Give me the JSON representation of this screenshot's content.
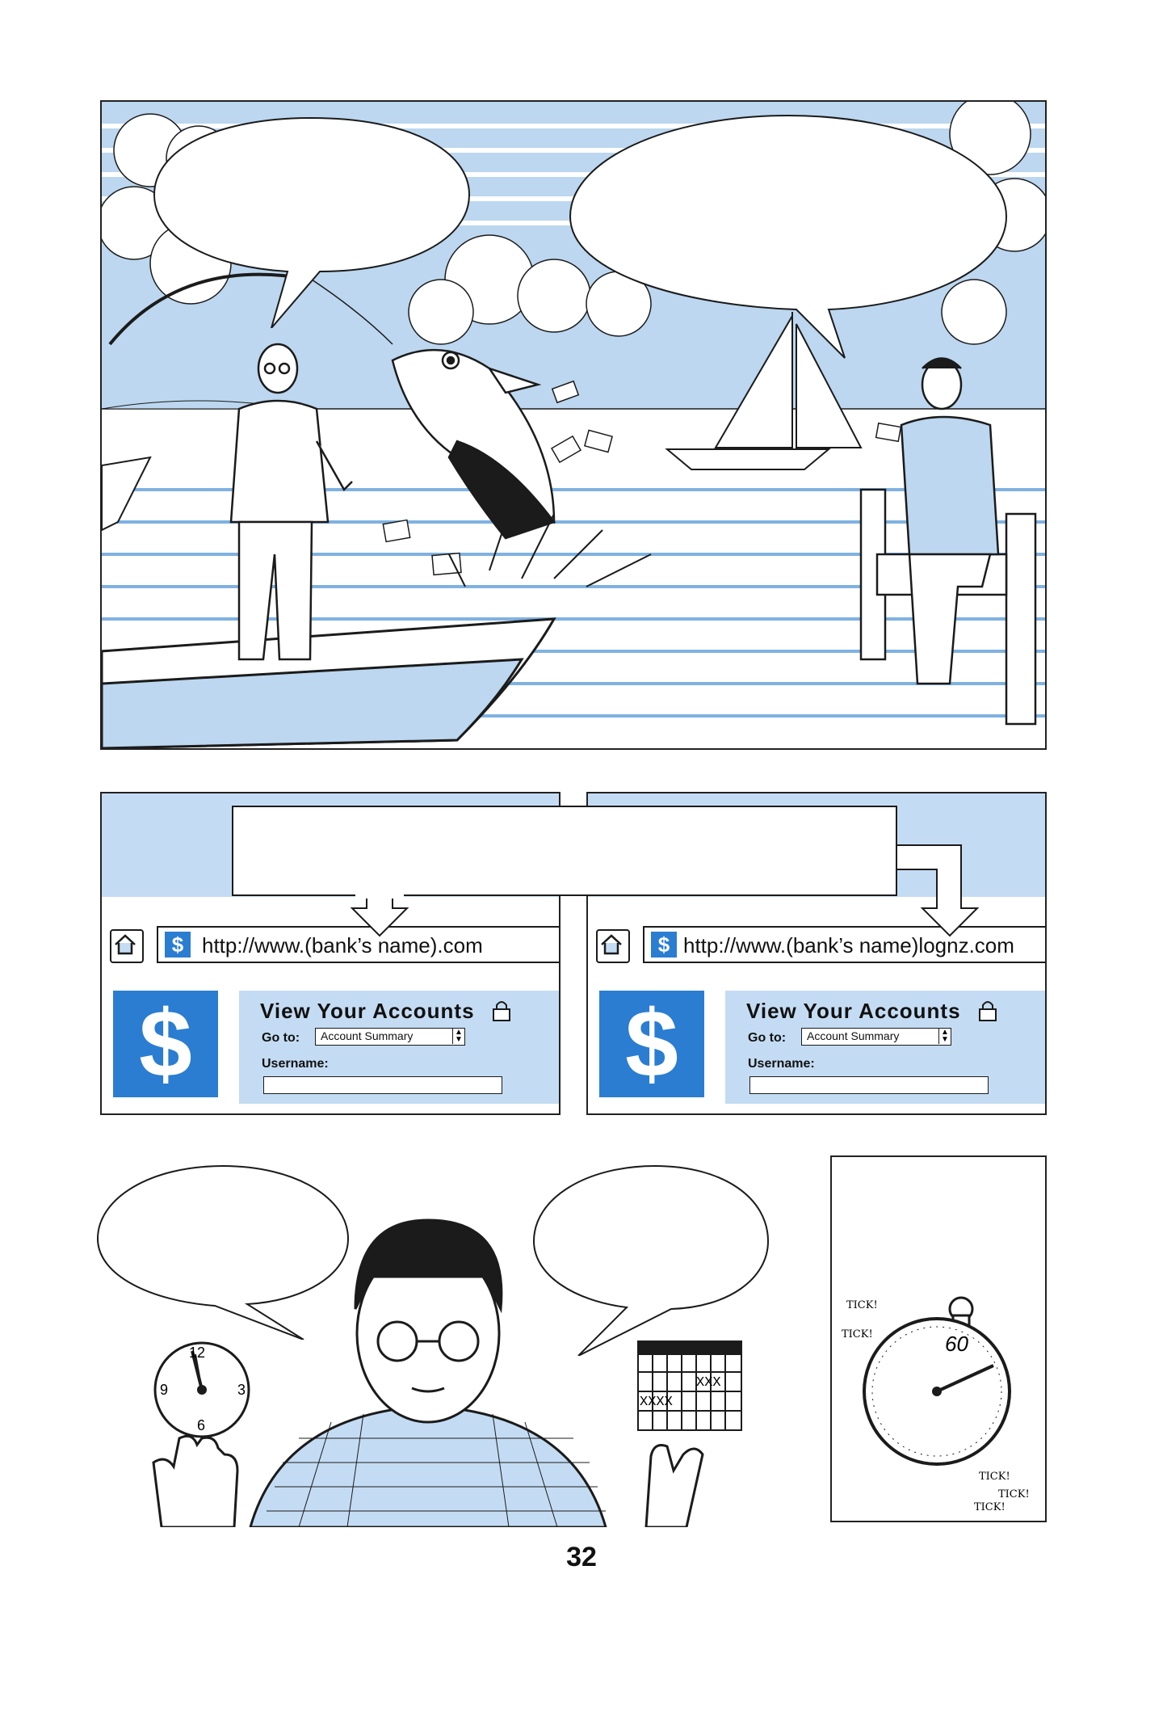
{
  "page": {
    "number": "32"
  },
  "colors": {
    "ink": "#1b1b1b",
    "sky": "#bcd7ef",
    "bank_blue": "#2a7dd1",
    "panel_blue": "#c4dcf3"
  },
  "panel1": {
    "scene": "fishing-phishing",
    "bubbles": [
      "",
      ""
    ]
  },
  "panel2": {
    "caption": "",
    "left_browser": {
      "url": "http://www.(bank’s name).com",
      "login_title": "View Your Accounts",
      "goto_label": "Go to:",
      "goto_selected": "Account Summary",
      "username_label": "Username:",
      "username_value": ""
    },
    "right_browser": {
      "url": "http://www.(bank’s name)lognz.com",
      "login_title": "View Your Accounts",
      "goto_label": "Go to:",
      "goto_selected": "Account Summary",
      "username_label": "Username:",
      "username_value": ""
    }
  },
  "panel3": {
    "bubbles": [
      "",
      ""
    ],
    "clock_numbers": [
      "12",
      "3",
      "6",
      "9"
    ],
    "calendar_marks": [
      "XXX",
      "XXXX"
    ]
  },
  "panel4": {
    "stopwatch_label": "60",
    "ticks": [
      "TICK!",
      "TICK!",
      "TICK!",
      "TICK!",
      "TICK!"
    ]
  }
}
